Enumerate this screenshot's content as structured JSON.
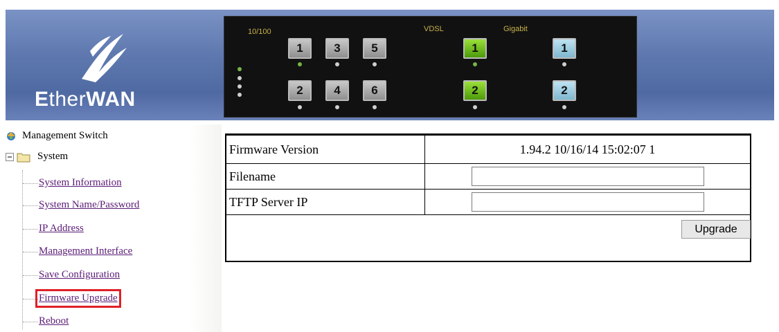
{
  "brand": {
    "logo_text_e": "E",
    "logo_text_ther": "ther",
    "logo_text_wan": "WAN"
  },
  "switch_panel": {
    "group_10_100_label": "10/100",
    "group_vdsl_label": "VDSL",
    "group_gigabit_label": "Gigabit",
    "ports_10_100_top": [
      "1",
      "3",
      "5"
    ],
    "ports_10_100_bottom": [
      "2",
      "4",
      "6"
    ],
    "ports_vdsl": [
      "1",
      "2"
    ],
    "ports_gigabit": [
      "1",
      "2"
    ]
  },
  "sidebar": {
    "root_label": "Management Switch",
    "system_label": "System",
    "items": [
      {
        "label": "System Information"
      },
      {
        "label": "System Name/Password"
      },
      {
        "label": "IP Address"
      },
      {
        "label": "Management Interface"
      },
      {
        "label": "Save Configuration"
      },
      {
        "label": "Firmware Upgrade",
        "selected": true
      },
      {
        "label": "Reboot"
      }
    ]
  },
  "firmware": {
    "version_label": "Firmware Version",
    "version_value": "1.94.2 10/16/14 15:02:07 1",
    "filename_label": "Filename",
    "filename_value": "",
    "tftp_label": "TFTP Server IP",
    "tftp_value": "",
    "upgrade_button": "Upgrade"
  },
  "colors": {
    "header_blue": "#5f79b0",
    "link_purple": "#5a1b76",
    "selection_red": "#e01f26"
  }
}
